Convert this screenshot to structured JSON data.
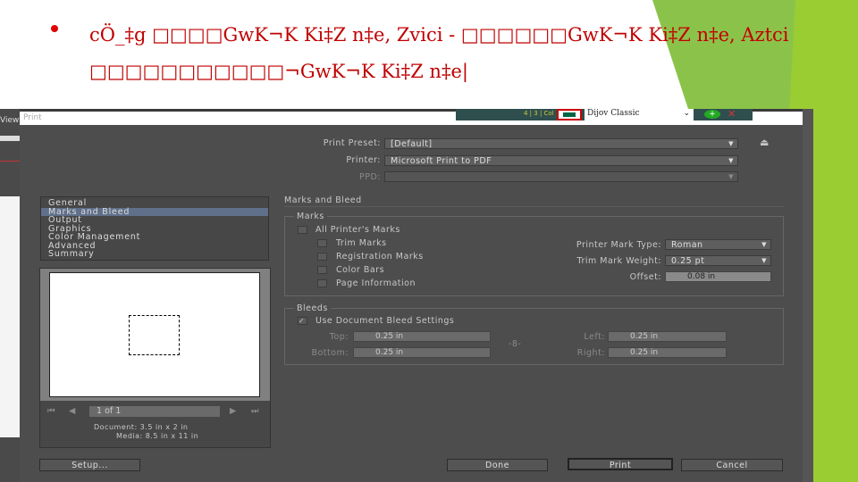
{
  "slide": {
    "line1": "cÖ_‡g □□□□GwK¬K Ki‡Z n‡e, Zvici - □□□□□□GwK¬K Ki‡Z n‡e, Aztci",
    "line2": "□□□□□□□□□□□¬GwK¬K Ki‡Z n‡e|",
    "accent": "#c00000"
  },
  "app": {
    "menu_fragment": "View",
    "toolbar_font": "Dijov Classic",
    "toolbar_stroke": "4 | 3 | Col"
  },
  "dialog": {
    "title": "Print",
    "print_preset": {
      "label": "Print Preset:",
      "value": "[Default]"
    },
    "printer": {
      "label": "Printer:",
      "value": "Microsoft Print to PDF"
    },
    "ppd": {
      "label": "PPD:",
      "value": ""
    },
    "categories": [
      "General",
      "Marks and Bleed",
      "Output",
      "Graphics",
      "Color Management",
      "Advanced",
      "Summary"
    ],
    "selected_category": "Marks and Bleed",
    "section_title": "Marks and Bleed",
    "marks": {
      "legend": "Marks",
      "all": "All Printer's Marks",
      "items": [
        "Trim Marks",
        "Registration Marks",
        "Color Bars",
        "Page Information"
      ],
      "mark_type": {
        "label": "Printer Mark Type:",
        "value": "Roman"
      },
      "trim_weight": {
        "label": "Trim Mark Weight:",
        "value": "0.25 pt"
      },
      "offset": {
        "label": "Offset:",
        "value": "0.08 in"
      }
    },
    "bleeds": {
      "legend": "Bleeds",
      "use_doc": "Use Document Bleed Settings",
      "use_doc_checked": true,
      "top": {
        "label": "Top:",
        "value": "0.25 in"
      },
      "bottom": {
        "label": "Bottom:",
        "value": "0.25 in"
      },
      "left": {
        "label": "Left:",
        "value": "0.25 in"
      },
      "right": {
        "label": "Right:",
        "value": "0.25 in"
      }
    },
    "preview": {
      "page": "1 of 1",
      "document": "Document: 3.5 in x 2 in",
      "media": "Media: 8.5 in x 11 in"
    },
    "buttons": {
      "setup": "Setup...",
      "done": "Done",
      "print": "Print",
      "cancel": "Cancel"
    }
  }
}
